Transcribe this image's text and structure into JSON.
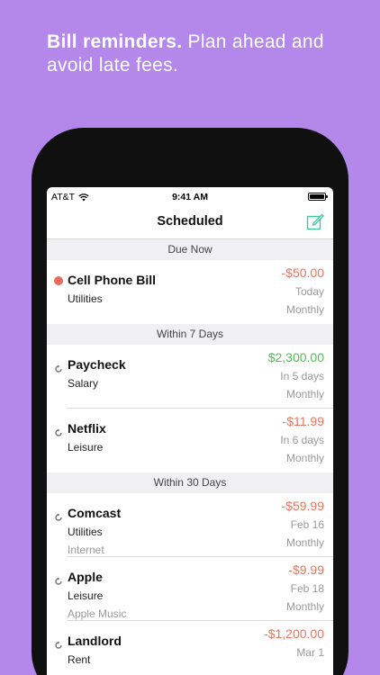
{
  "promo": {
    "bold": "Bill reminders.",
    "rest": " Plan ahead and avoid late fees."
  },
  "status": {
    "carrier": "AT&T",
    "time": "9:41 AM"
  },
  "nav": {
    "title": "Scheduled"
  },
  "colors": {
    "background": "#b388ea",
    "negative": "#e8765f",
    "positive": "#4cc14a",
    "accent": "#3ec7a0",
    "due_dot": "#ea6b5e"
  },
  "sections": [
    {
      "title": "Due Now",
      "items": [
        {
          "name": "Cell Phone Bill",
          "category": "Utilities",
          "note": "",
          "amount": "-$50.00",
          "when": "Today",
          "frequency": "Monthly",
          "icon": "due-dot"
        }
      ]
    },
    {
      "title": "Within 7 Days",
      "items": [
        {
          "name": "Paycheck",
          "category": "Salary",
          "note": "",
          "amount": "$2,300.00",
          "when": "In 5 days",
          "frequency": "Monthly",
          "icon": "repeat-icon"
        },
        {
          "name": "Netflix",
          "category": "Leisure",
          "note": "",
          "amount": "-$11.99",
          "when": "In 6 days",
          "frequency": "Monthly",
          "icon": "repeat-icon"
        }
      ]
    },
    {
      "title": "Within 30 Days",
      "items": [
        {
          "name": "Comcast",
          "category": "Utilities",
          "note": "Internet",
          "amount": "-$59.99",
          "when": "Feb 16",
          "frequency": "Monthly",
          "icon": "repeat-icon"
        },
        {
          "name": "Apple",
          "category": "Leisure",
          "note": "Apple Music",
          "amount": "-$9.99",
          "when": "Feb 18",
          "frequency": "Monthly",
          "icon": "repeat-icon"
        },
        {
          "name": "Landlord",
          "category": "Rent",
          "note": "",
          "amount": "-$1,200.00",
          "when": "Mar 1",
          "frequency": "",
          "icon": "repeat-icon"
        }
      ]
    }
  ],
  "tabbar": [
    "printer-icon",
    "pie-chart-icon",
    "calendar-icon",
    "gear-icon"
  ]
}
